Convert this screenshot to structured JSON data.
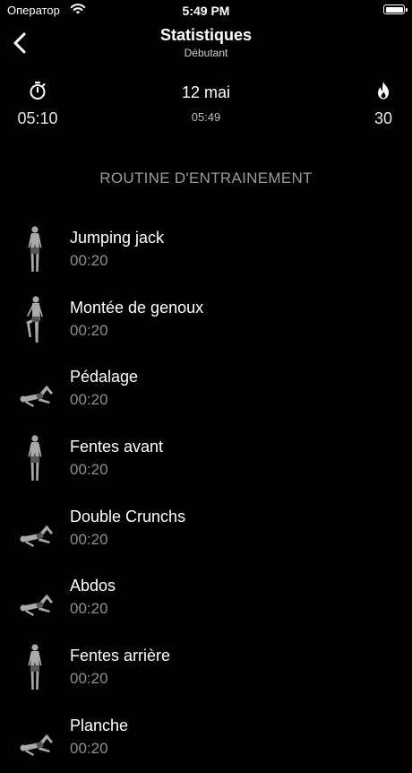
{
  "status_bar": {
    "carrier": "Оператор",
    "time": "5:49 PM"
  },
  "header": {
    "title": "Statistiques",
    "subtitle": "Débutant"
  },
  "stats": {
    "duration": "05:10",
    "date": "12 mai",
    "time": "05:49",
    "calories": "30"
  },
  "routine": {
    "heading": "ROUTINE D'ENTRAINEMENT",
    "exercises": [
      {
        "name": "Jumping jack",
        "duration": "00:20",
        "pose": "standing"
      },
      {
        "name": "Montée de genoux",
        "duration": "00:20",
        "pose": "knee"
      },
      {
        "name": "Pédalage",
        "duration": "00:20",
        "pose": "lying"
      },
      {
        "name": "Fentes avant",
        "duration": "00:20",
        "pose": "standing"
      },
      {
        "name": "Double Crunchs",
        "duration": "00:20",
        "pose": "lying"
      },
      {
        "name": "Abdos",
        "duration": "00:20",
        "pose": "lying"
      },
      {
        "name": "Fentes arrière",
        "duration": "00:20",
        "pose": "standing"
      },
      {
        "name": "Planche",
        "duration": "00:20",
        "pose": "lying"
      }
    ]
  }
}
